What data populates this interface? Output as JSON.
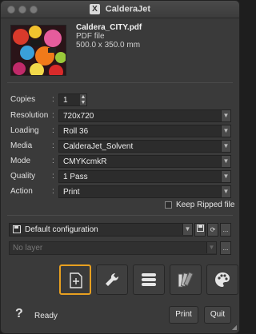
{
  "window": {
    "title": "CalderaJet",
    "app_icon_glyph": "X"
  },
  "file": {
    "name": "Caldera_CITY.pdf",
    "type": "PDF file",
    "dimensions": "500.0 x 350.0 mm"
  },
  "settings": {
    "copies": {
      "label": "Copies",
      "value": "1"
    },
    "resolution": {
      "label": "Resolution",
      "value": "720x720"
    },
    "loading": {
      "label": "Loading",
      "value": "Roll 36"
    },
    "media": {
      "label": "Media",
      "value": "CalderaJet_Solvent"
    },
    "mode": {
      "label": "Mode",
      "value": "CMYKcmkR"
    },
    "quality": {
      "label": "Quality",
      "value": "1 Pass"
    },
    "action": {
      "label": "Action",
      "value": "Print"
    },
    "colon": ":"
  },
  "keep_ripped": {
    "label": "Keep Ripped file",
    "checked": false
  },
  "configuration": {
    "value": "Default configuration",
    "more": "..."
  },
  "layer": {
    "placeholder": "No layer",
    "more": "..."
  },
  "tools": [
    {
      "icon": "add-page-icon",
      "active": true
    },
    {
      "icon": "wrench-icon",
      "active": false
    },
    {
      "icon": "list-icon",
      "active": false
    },
    {
      "icon": "swatches-icon",
      "active": false
    },
    {
      "icon": "palette-icon",
      "active": false
    }
  ],
  "footer": {
    "help": "?",
    "status": "Ready",
    "print_label": "Print",
    "quit_label": "Quit"
  },
  "colors": {
    "accent": "#e8a020",
    "background": "#3a3a3a"
  }
}
